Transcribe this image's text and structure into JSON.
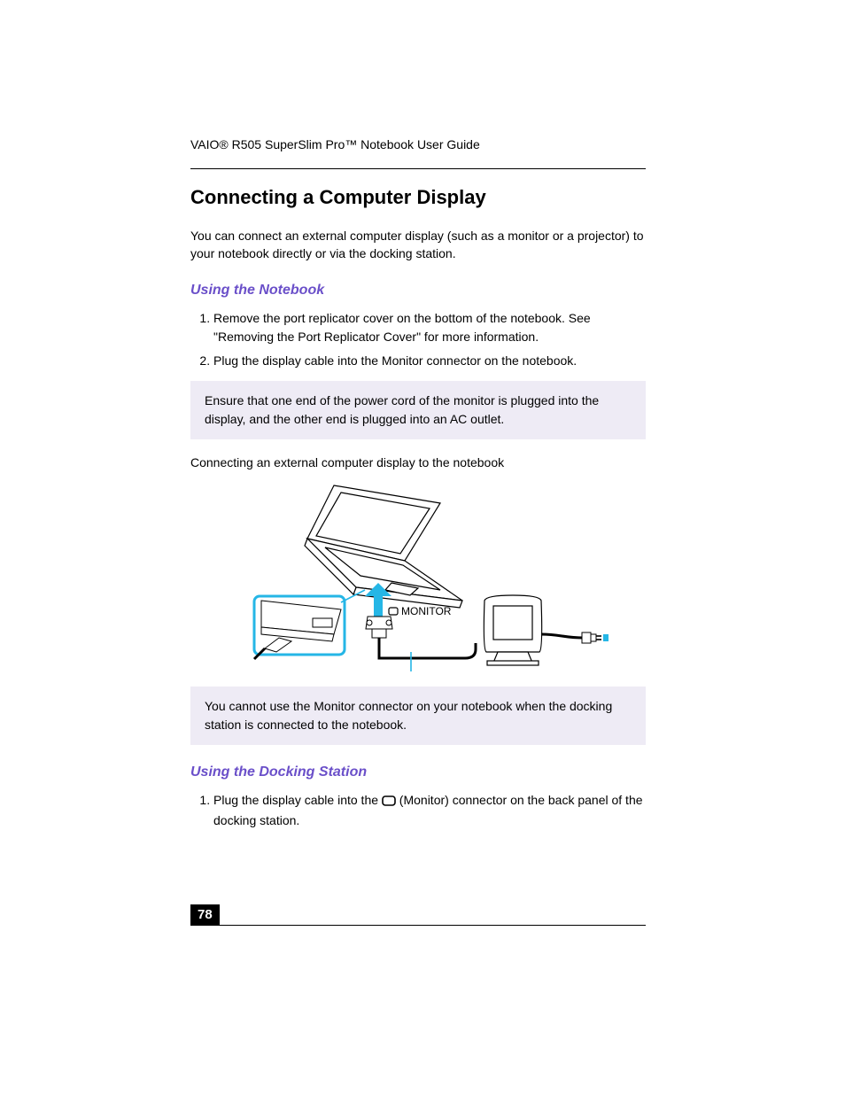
{
  "running_header": "VAIO® R505 SuperSlim Pro™ Notebook User Guide",
  "section_title": "Connecting a Computer Display",
  "body_intro_1": "You can connect an external computer display (such as a monitor or a projector) to your notebook directly or via the docking station.",
  "subhead_1": "Using the Notebook",
  "steps_1": [
    "Remove the port replicator cover on the bottom of the notebook. See \"Removing the Port Replicator Cover\" for more information.",
    "Plug the display cable into the Monitor connector on the notebook."
  ],
  "note_1": "Ensure that one end of the power cord of the monitor is plugged into the display, and the other end is plugged into an AC outlet.",
  "figure_1_caption": "Connecting an external computer display to the notebook",
  "figure_1_label": "MONITOR",
  "note_2": "You cannot use the Monitor connector on your notebook when the docking station is connected to the notebook.",
  "subhead_2": "Using the Docking Station",
  "steps_2_prefix": "Plug the display cable into the ",
  "steps_2_suffix": " (Monitor) connector on the back panel of the docking station.",
  "page_number": "78"
}
